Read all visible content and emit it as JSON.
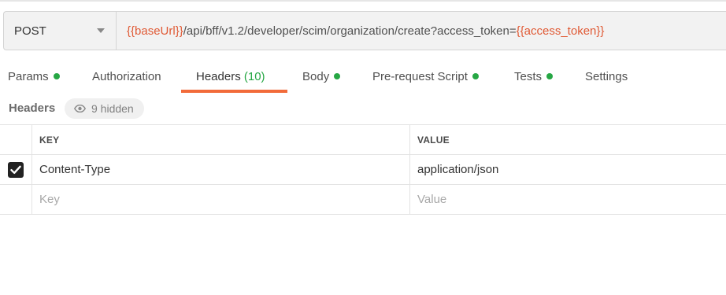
{
  "request": {
    "method": "POST",
    "url_parts": [
      {
        "text": "{{baseUrl}}",
        "kind": "variable"
      },
      {
        "text": "/api/bff/v1.2/developer/scim/organization/create?access_token=",
        "kind": "plain"
      },
      {
        "text": "{{access_token}}",
        "kind": "variable"
      }
    ]
  },
  "tabs": [
    {
      "label": "Params",
      "dot": true
    },
    {
      "label": "Authorization",
      "dot": false
    },
    {
      "label": "Headers",
      "count": "(10)",
      "active": true
    },
    {
      "label": "Body",
      "dot": true
    },
    {
      "label": "Pre-request Script",
      "dot": true
    },
    {
      "label": "Tests",
      "dot": true
    },
    {
      "label": "Settings",
      "dot": false
    }
  ],
  "headers_section": {
    "label": "Headers",
    "hidden_text": "9 hidden"
  },
  "table": {
    "columns": {
      "key": "KEY",
      "value": "VALUE"
    },
    "rows": [
      {
        "checked": true,
        "key": "Content-Type",
        "value": "application/json"
      }
    ],
    "new_row": {
      "key_placeholder": "Key",
      "value_placeholder": "Value"
    }
  },
  "colors": {
    "variable": "#e05a35",
    "active_tab_underline": "#f26b3a",
    "status_dot": "#26a744"
  }
}
